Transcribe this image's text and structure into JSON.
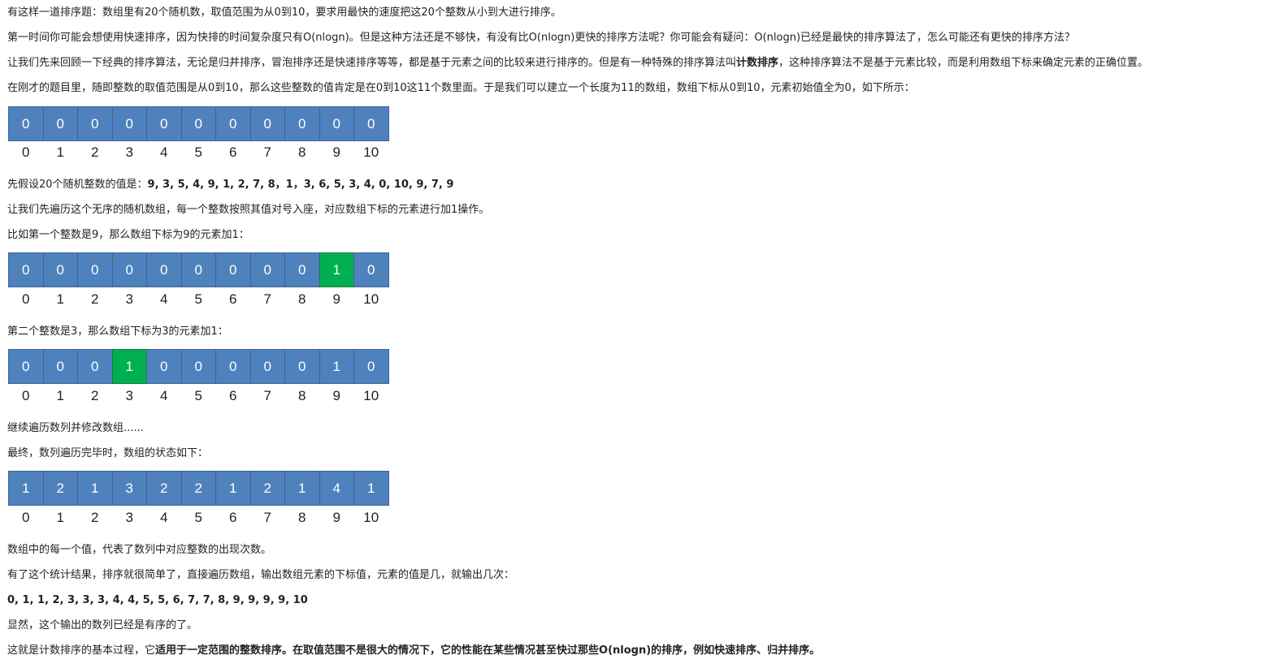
{
  "paragraphs": {
    "p1": "有这样一道排序题：数组里有20个随机数，取值范围为从0到10，要求用最快的速度把这20个整数从小到大进行排序。",
    "p2": "第一时间你可能会想使用快速排序，因为快排的时间复杂度只有O(nlogn)。但是这种方法还是不够快，有没有比O(nlogn)更快的排序方法呢？你可能会有疑问：O(nlogn)已经是最快的排序算法了，怎么可能还有更快的排序方法？",
    "p3a": "让我们先来回顾一下经典的排序算法，无论是归并排序，冒泡排序还是快速排序等等，都是基于元素之间的比较来进行排序的。但是有一种特殊的排序算法叫",
    "p3b": "计数排序",
    "p3c": "，这种排序算法不是基于元素比较，而是利用数组下标来确定元素的正确位置。",
    "p4": "在刚才的题目里，随即整数的取值范围是从0到10，那么这些整数的值肯定是在0到10这11个数里面。于是我们可以建立一个长度为11的数组，数组下标从0到10，元素初始值全为0，如下所示：",
    "p5a": "先假设20个随机整数的值是：",
    "p5b": "9, 3, 5, 4, 9, 1, 2, 7, 8，1，3, 6, 5, 3, 4, 0, 10, 9, 7, 9",
    "p6": "让我们先遍历这个无序的随机数组，每一个整数按照其值对号入座，对应数组下标的元素进行加1操作。",
    "p7": "比如第一个整数是9，那么数组下标为9的元素加1：",
    "p8": "第二个整数是3，那么数组下标为3的元素加1：",
    "p9": "继续遍历数列并修改数组......",
    "p10": "最终，数列遍历完毕时，数组的状态如下：",
    "p11": "数组中的每一个值，代表了数列中对应整数的出现次数。",
    "p12": "有了这个统计结果，排序就很简单了，直接遍历数组，输出数组元素的下标值，元素的值是几，就输出几次：",
    "p13": "0, 1, 1, 2, 3, 3, 3, 4, 4, 5, 5, 6, 7, 7, 8, 9, 9, 9, 9, 10",
    "p14": "显然，这个输出的数列已经是有序的了。",
    "p15a": "这就是计数排序的基本过程，它",
    "p15b": "适用于一定范围的整数排序。在取值范围不是很大的情况下，它的性能在某些情况甚至快过那些O(nlogn)的排序，例如快速排序、归并排序。"
  },
  "colors": {
    "cell": "#4f81bd",
    "highlight": "#00b050"
  },
  "arrays": {
    "indices": [
      "0",
      "1",
      "2",
      "3",
      "4",
      "5",
      "6",
      "7",
      "8",
      "9",
      "10"
    ],
    "a1": {
      "values": [
        "0",
        "0",
        "0",
        "0",
        "0",
        "0",
        "0",
        "0",
        "0",
        "0",
        "0"
      ],
      "highlight": []
    },
    "a2": {
      "values": [
        "0",
        "0",
        "0",
        "0",
        "0",
        "0",
        "0",
        "0",
        "0",
        "1",
        "0"
      ],
      "highlight": [
        9
      ]
    },
    "a3": {
      "values": [
        "0",
        "0",
        "0",
        "1",
        "0",
        "0",
        "0",
        "0",
        "0",
        "1",
        "0"
      ],
      "highlight": [
        3
      ]
    },
    "a4": {
      "values": [
        "1",
        "2",
        "1",
        "3",
        "2",
        "2",
        "1",
        "2",
        "1",
        "4",
        "1"
      ],
      "highlight": []
    }
  }
}
